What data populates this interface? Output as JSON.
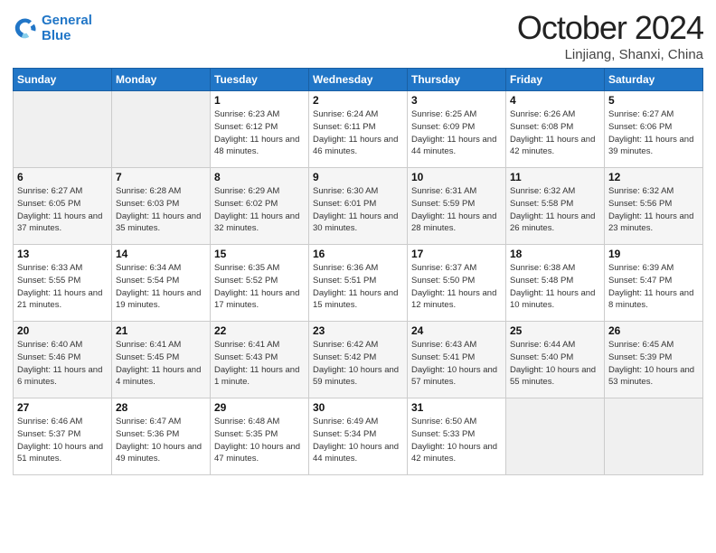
{
  "header": {
    "logo_line1": "General",
    "logo_line2": "Blue",
    "month": "October 2024",
    "location": "Linjiang, Shanxi, China"
  },
  "weekdays": [
    "Sunday",
    "Monday",
    "Tuesday",
    "Wednesday",
    "Thursday",
    "Friday",
    "Saturday"
  ],
  "weeks": [
    [
      null,
      null,
      {
        "day": "1",
        "sunrise": "Sunrise: 6:23 AM",
        "sunset": "Sunset: 6:12 PM",
        "daylight": "Daylight: 11 hours and 48 minutes."
      },
      {
        "day": "2",
        "sunrise": "Sunrise: 6:24 AM",
        "sunset": "Sunset: 6:11 PM",
        "daylight": "Daylight: 11 hours and 46 minutes."
      },
      {
        "day": "3",
        "sunrise": "Sunrise: 6:25 AM",
        "sunset": "Sunset: 6:09 PM",
        "daylight": "Daylight: 11 hours and 44 minutes."
      },
      {
        "day": "4",
        "sunrise": "Sunrise: 6:26 AM",
        "sunset": "Sunset: 6:08 PM",
        "daylight": "Daylight: 11 hours and 42 minutes."
      },
      {
        "day": "5",
        "sunrise": "Sunrise: 6:27 AM",
        "sunset": "Sunset: 6:06 PM",
        "daylight": "Daylight: 11 hours and 39 minutes."
      }
    ],
    [
      {
        "day": "6",
        "sunrise": "Sunrise: 6:27 AM",
        "sunset": "Sunset: 6:05 PM",
        "daylight": "Daylight: 11 hours and 37 minutes."
      },
      {
        "day": "7",
        "sunrise": "Sunrise: 6:28 AM",
        "sunset": "Sunset: 6:03 PM",
        "daylight": "Daylight: 11 hours and 35 minutes."
      },
      {
        "day": "8",
        "sunrise": "Sunrise: 6:29 AM",
        "sunset": "Sunset: 6:02 PM",
        "daylight": "Daylight: 11 hours and 32 minutes."
      },
      {
        "day": "9",
        "sunrise": "Sunrise: 6:30 AM",
        "sunset": "Sunset: 6:01 PM",
        "daylight": "Daylight: 11 hours and 30 minutes."
      },
      {
        "day": "10",
        "sunrise": "Sunrise: 6:31 AM",
        "sunset": "Sunset: 5:59 PM",
        "daylight": "Daylight: 11 hours and 28 minutes."
      },
      {
        "day": "11",
        "sunrise": "Sunrise: 6:32 AM",
        "sunset": "Sunset: 5:58 PM",
        "daylight": "Daylight: 11 hours and 26 minutes."
      },
      {
        "day": "12",
        "sunrise": "Sunrise: 6:32 AM",
        "sunset": "Sunset: 5:56 PM",
        "daylight": "Daylight: 11 hours and 23 minutes."
      }
    ],
    [
      {
        "day": "13",
        "sunrise": "Sunrise: 6:33 AM",
        "sunset": "Sunset: 5:55 PM",
        "daylight": "Daylight: 11 hours and 21 minutes."
      },
      {
        "day": "14",
        "sunrise": "Sunrise: 6:34 AM",
        "sunset": "Sunset: 5:54 PM",
        "daylight": "Daylight: 11 hours and 19 minutes."
      },
      {
        "day": "15",
        "sunrise": "Sunrise: 6:35 AM",
        "sunset": "Sunset: 5:52 PM",
        "daylight": "Daylight: 11 hours and 17 minutes."
      },
      {
        "day": "16",
        "sunrise": "Sunrise: 6:36 AM",
        "sunset": "Sunset: 5:51 PM",
        "daylight": "Daylight: 11 hours and 15 minutes."
      },
      {
        "day": "17",
        "sunrise": "Sunrise: 6:37 AM",
        "sunset": "Sunset: 5:50 PM",
        "daylight": "Daylight: 11 hours and 12 minutes."
      },
      {
        "day": "18",
        "sunrise": "Sunrise: 6:38 AM",
        "sunset": "Sunset: 5:48 PM",
        "daylight": "Daylight: 11 hours and 10 minutes."
      },
      {
        "day": "19",
        "sunrise": "Sunrise: 6:39 AM",
        "sunset": "Sunset: 5:47 PM",
        "daylight": "Daylight: 11 hours and 8 minutes."
      }
    ],
    [
      {
        "day": "20",
        "sunrise": "Sunrise: 6:40 AM",
        "sunset": "Sunset: 5:46 PM",
        "daylight": "Daylight: 11 hours and 6 minutes."
      },
      {
        "day": "21",
        "sunrise": "Sunrise: 6:41 AM",
        "sunset": "Sunset: 5:45 PM",
        "daylight": "Daylight: 11 hours and 4 minutes."
      },
      {
        "day": "22",
        "sunrise": "Sunrise: 6:41 AM",
        "sunset": "Sunset: 5:43 PM",
        "daylight": "Daylight: 11 hours and 1 minute."
      },
      {
        "day": "23",
        "sunrise": "Sunrise: 6:42 AM",
        "sunset": "Sunset: 5:42 PM",
        "daylight": "Daylight: 10 hours and 59 minutes."
      },
      {
        "day": "24",
        "sunrise": "Sunrise: 6:43 AM",
        "sunset": "Sunset: 5:41 PM",
        "daylight": "Daylight: 10 hours and 57 minutes."
      },
      {
        "day": "25",
        "sunrise": "Sunrise: 6:44 AM",
        "sunset": "Sunset: 5:40 PM",
        "daylight": "Daylight: 10 hours and 55 minutes."
      },
      {
        "day": "26",
        "sunrise": "Sunrise: 6:45 AM",
        "sunset": "Sunset: 5:39 PM",
        "daylight": "Daylight: 10 hours and 53 minutes."
      }
    ],
    [
      {
        "day": "27",
        "sunrise": "Sunrise: 6:46 AM",
        "sunset": "Sunset: 5:37 PM",
        "daylight": "Daylight: 10 hours and 51 minutes."
      },
      {
        "day": "28",
        "sunrise": "Sunrise: 6:47 AM",
        "sunset": "Sunset: 5:36 PM",
        "daylight": "Daylight: 10 hours and 49 minutes."
      },
      {
        "day": "29",
        "sunrise": "Sunrise: 6:48 AM",
        "sunset": "Sunset: 5:35 PM",
        "daylight": "Daylight: 10 hours and 47 minutes."
      },
      {
        "day": "30",
        "sunrise": "Sunrise: 6:49 AM",
        "sunset": "Sunset: 5:34 PM",
        "daylight": "Daylight: 10 hours and 44 minutes."
      },
      {
        "day": "31",
        "sunrise": "Sunrise: 6:50 AM",
        "sunset": "Sunset: 5:33 PM",
        "daylight": "Daylight: 10 hours and 42 minutes."
      },
      null,
      null
    ]
  ]
}
